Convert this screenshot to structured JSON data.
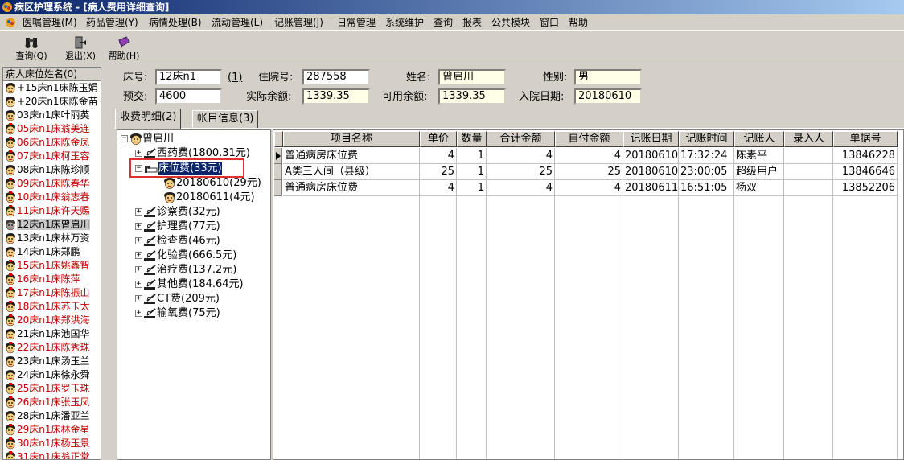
{
  "window": {
    "title": "病区护理系统 - [病人费用详细查询]"
  },
  "menu": [
    "医嘱管理(M)",
    "药品管理(Y)",
    "病情处理(B)",
    "流动管理(L)",
    "记账管理(J)",
    "日常管理",
    "系统维护",
    "查询",
    "报表",
    "公共模块",
    "窗口",
    "帮助"
  ],
  "toolbar": {
    "query": "查询(Q)",
    "exit": "退出(X)",
    "help": "帮助(H)"
  },
  "left_panel": {
    "header": "病人床位姓名(0)",
    "patients": [
      {
        "label": "+15床n1床陈玉娟",
        "color": "black"
      },
      {
        "label": "+20床n1床陈金苗",
        "color": "black"
      },
      {
        "label": "03床n1床叶丽英",
        "color": "black"
      },
      {
        "label": "05床n1床翁美连",
        "color": "red"
      },
      {
        "label": "06床n1床陈金凤",
        "color": "red"
      },
      {
        "label": "07床n1床柯玉容",
        "color": "red"
      },
      {
        "label": "08床n1床陈珍顺",
        "color": "black"
      },
      {
        "label": "09床n1床陈春华",
        "color": "red"
      },
      {
        "label": "10床n1床翁志春",
        "color": "red"
      },
      {
        "label": "11床n1床许天赐",
        "color": "red"
      },
      {
        "label": "12床n1床曾启川",
        "color": "black",
        "selected": true
      },
      {
        "label": "13床n1床林万资",
        "color": "black"
      },
      {
        "label": "14床n1床郑鹏",
        "color": "black"
      },
      {
        "label": "15床n1床姚鑫智",
        "color": "red"
      },
      {
        "label": "16床n1床陈萍",
        "color": "red"
      },
      {
        "label": "17床n1床陈振山",
        "color": "red"
      },
      {
        "label": "18床n1床苏玉太",
        "color": "red"
      },
      {
        "label": "20床n1床郑洪海",
        "color": "red"
      },
      {
        "label": "21床n1床池国华",
        "color": "black"
      },
      {
        "label": "22床n1床陈秀珠",
        "color": "red"
      },
      {
        "label": "23床n1床汤玉兰",
        "color": "black"
      },
      {
        "label": "24床n1床徐永舜",
        "color": "black"
      },
      {
        "label": "25床n1床罗玉珠",
        "color": "red"
      },
      {
        "label": "26床n1床张玉凤",
        "color": "red"
      },
      {
        "label": "28床n1床潘亚兰",
        "color": "black"
      },
      {
        "label": "29床n1床林金星",
        "color": "red"
      },
      {
        "label": "30床n1床杨玉景",
        "color": "red"
      },
      {
        "label": "31床n1床翁正堂",
        "color": "red"
      }
    ]
  },
  "info": {
    "bed_label": "床号:",
    "bed_value": "12床n1",
    "bed_suffix": "(1)",
    "admission_label": "住院号:",
    "admission_value": "287558",
    "name_label": "姓名:",
    "name_value": "曾启川",
    "gender_label": "性别:",
    "gender_value": "男",
    "deposit_label": "预交:",
    "deposit_value": "4600",
    "balance_label": "实际余额:",
    "balance_value": "1339.35",
    "available_label": "可用余额:",
    "available_value": "1339.35",
    "date_label": "入院日期:",
    "date_value": "20180610"
  },
  "tabs": [
    "收费明细(2)",
    "帐目信息(3)"
  ],
  "tree": {
    "root": "曾启川",
    "nodes": [
      {
        "label": "西药费(1800.31元)"
      },
      {
        "label": "床位费(33元)",
        "selected": true
      },
      {
        "label": "20180610(29元)"
      },
      {
        "label": "20180611(4元)"
      },
      {
        "label": "诊察费(32元)"
      },
      {
        "label": "护理费(77元)"
      },
      {
        "label": "检查费(46元)"
      },
      {
        "label": "化验费(666.5元)"
      },
      {
        "label": "治疗费(137.2元)"
      },
      {
        "label": "其他费(184.64元)"
      },
      {
        "label": "CT费(209元)"
      },
      {
        "label": "输氧费(75元)"
      }
    ]
  },
  "grid": {
    "columns": [
      "项目名称",
      "单价",
      "数量",
      "合计金额",
      "自付金额",
      "记账日期",
      "记账时间",
      "记账人",
      "录入人",
      "单据号"
    ],
    "rows": [
      [
        "普通病房床位费",
        "4",
        "1",
        "4",
        "4",
        "20180610",
        "17:32:24",
        "陈素平",
        "",
        "13846228"
      ],
      [
        "A类三人间（县级）",
        "25",
        "1",
        "25",
        "25",
        "20180610",
        "23:00:05",
        "超级用户",
        "",
        "13846646"
      ],
      [
        "普通病房床位费",
        "4",
        "1",
        "4",
        "4",
        "20180611",
        "16:51:05",
        "杨双",
        "",
        "13852206"
      ]
    ]
  },
  "colors": {
    "title_bar": "#0a246a",
    "selection": "#0a246a",
    "alert_text": "#c00000",
    "highlight_box": "#e0302b"
  }
}
